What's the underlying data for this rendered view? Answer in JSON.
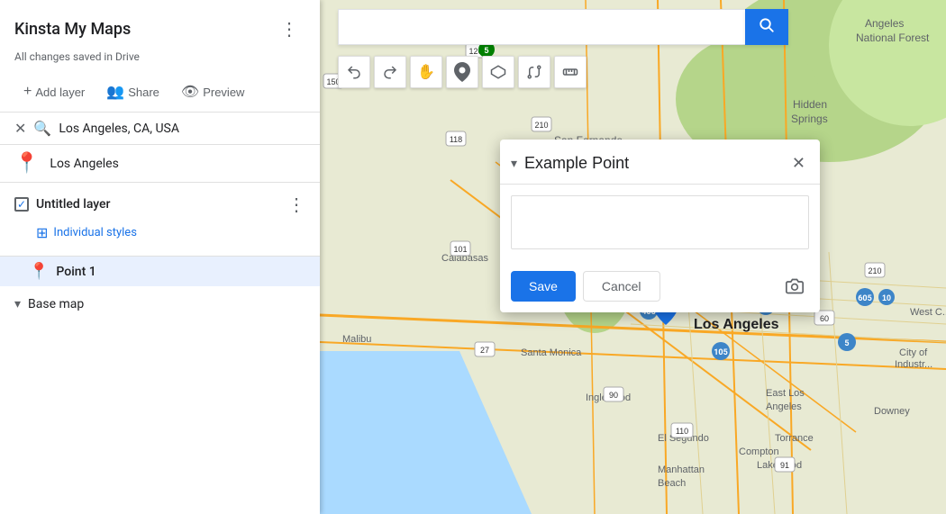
{
  "sidebar": {
    "title": "Kinsta My Maps",
    "saved_status": "All changes saved in Drive",
    "more_icon": "⋮",
    "toolbar": {
      "add_layer": "Add layer",
      "share": "Share",
      "preview": "Preview"
    },
    "search": {
      "query": "Los Angeles, CA, USA"
    },
    "search_result": {
      "text": "Los Angeles"
    },
    "layer": {
      "title": "Untitled layer",
      "styles_label": "Individual styles"
    },
    "point": {
      "label": "Point 1"
    },
    "basemap": {
      "label": "Base map"
    }
  },
  "top_search": {
    "placeholder": ""
  },
  "map_tools": {
    "undo": "↩",
    "redo": "↪",
    "hand": "✋",
    "pin": "📍",
    "polygon": "⬡",
    "route": "🔀",
    "ruler": "📏"
  },
  "popup": {
    "title": "Example Point",
    "textarea_placeholder": "",
    "save_label": "Save",
    "cancel_label": "Cancel"
  },
  "icons": {
    "search": "🔍",
    "close": "✕",
    "chevron_down": "▾",
    "layer_icon": "☰",
    "add_layer": "➕",
    "share": "👥",
    "preview": "👁",
    "styles_icon": "⊟",
    "camera": "📷",
    "checkmark": "✓"
  }
}
